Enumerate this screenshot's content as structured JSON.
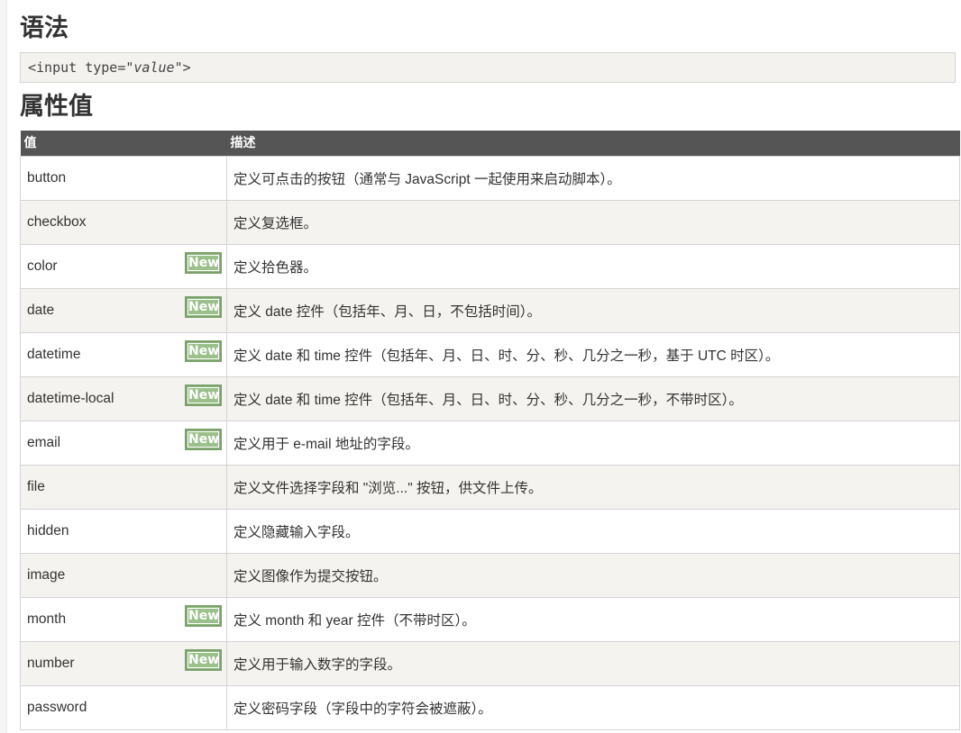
{
  "syntax": {
    "heading": "语法",
    "code_prefix": "<input type=\"",
    "code_value": "value",
    "code_suffix": "\">"
  },
  "attributes": {
    "heading": "属性值",
    "columns": [
      "值",
      "描述"
    ],
    "badge_label": "New",
    "badge_color": "#8fb67f",
    "rows": [
      {
        "value": "button",
        "is_new": false,
        "description": "定义可点击的按钮（通常与 JavaScript 一起使用来启动脚本）。"
      },
      {
        "value": "checkbox",
        "is_new": false,
        "description": "定义复选框。"
      },
      {
        "value": "color",
        "is_new": true,
        "description": "定义拾色器。"
      },
      {
        "value": "date",
        "is_new": true,
        "description": "定义 date 控件（包括年、月、日，不包括时间）。"
      },
      {
        "value": "datetime",
        "is_new": true,
        "description": "定义 date 和 time 控件（包括年、月、日、时、分、秒、几分之一秒，基于 UTC 时区）。"
      },
      {
        "value": "datetime-local",
        "is_new": true,
        "description": "定义 date 和 time 控件（包括年、月、日、时、分、秒、几分之一秒，不带时区）。"
      },
      {
        "value": "email",
        "is_new": true,
        "description": "定义用于 e-mail 地址的字段。"
      },
      {
        "value": "file",
        "is_new": false,
        "description": "定义文件选择字段和 \"浏览...\" 按钮，供文件上传。"
      },
      {
        "value": "hidden",
        "is_new": false,
        "description": "定义隐藏输入字段。"
      },
      {
        "value": "image",
        "is_new": false,
        "description": "定义图像作为提交按钮。"
      },
      {
        "value": "month",
        "is_new": true,
        "description": "定义 month 和 year 控件（不带时区）。"
      },
      {
        "value": "number",
        "is_new": true,
        "description": "定义用于输入数字的字段。"
      },
      {
        "value": "password",
        "is_new": false,
        "description": "定义密码字段（字段中的字符会被遮蔽）。"
      }
    ]
  }
}
